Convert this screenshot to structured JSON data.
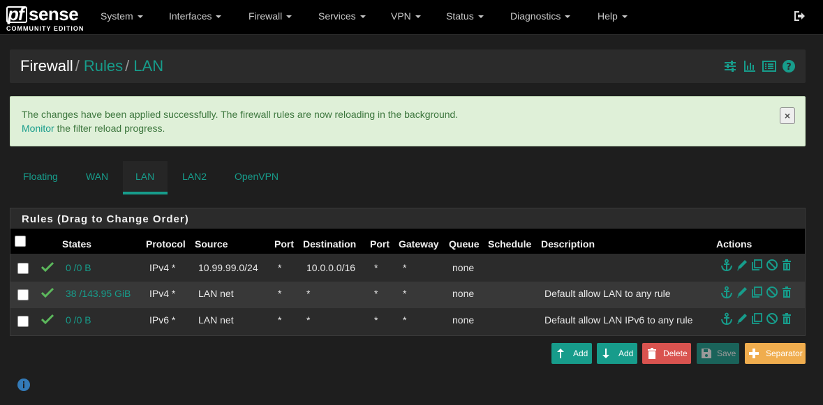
{
  "brand": {
    "logo_pf": "pf",
    "logo_sense": "sense",
    "edition": "COMMUNITY EDITION"
  },
  "nav": {
    "items": [
      "System",
      "Interfaces",
      "Firewall",
      "Services",
      "VPN",
      "Status",
      "Diagnostics",
      "Help"
    ]
  },
  "breadcrumb": {
    "root": "Firewall",
    "sep1": "/",
    "level1": "Rules",
    "sep2": "/",
    "level2": "LAN"
  },
  "alert": {
    "message": "The changes have been applied successfully. The firewall rules are now reloading in the background.",
    "link": "Monitor",
    "suffix": " the filter reload progress.",
    "close": "×"
  },
  "tabs": [
    "Floating",
    "WAN",
    "LAN",
    "LAN2",
    "OpenVPN"
  ],
  "active_tab": "LAN",
  "rules": {
    "title": "Rules (Drag to Change Order)",
    "columns": [
      "States",
      "Protocol",
      "Source",
      "Port",
      "Destination",
      "Port",
      "Gateway",
      "Queue",
      "Schedule",
      "Description",
      "Actions"
    ],
    "rows": [
      {
        "states": "0 /0 B",
        "protocol": "IPv4 *",
        "source": "10.99.99.0/24",
        "sport": "*",
        "destination": "10.0.0.0/16",
        "dport": "*",
        "gateway": "*",
        "queue": "none",
        "schedule": "",
        "description": ""
      },
      {
        "states": "38 /143.95 GiB",
        "protocol": "IPv4 *",
        "source": "LAN net",
        "sport": "*",
        "destination": "*",
        "dport": "*",
        "gateway": "*",
        "queue": "none",
        "schedule": "",
        "description": "Default allow LAN to any rule"
      },
      {
        "states": "0 /0 B",
        "protocol": "IPv6 *",
        "source": "LAN net",
        "sport": "*",
        "destination": "*",
        "dport": "*",
        "gateway": "*",
        "queue": "none",
        "schedule": "",
        "description": "Default allow LAN IPv6 to any rule"
      }
    ]
  },
  "buttons": {
    "add_top": "Add",
    "add_bottom": "Add",
    "delete": "Delete",
    "save": "Save",
    "separator": "Separator"
  },
  "colors": {
    "accent": "#179c8b",
    "success": "#5cb85c",
    "danger": "#d9534f",
    "warning": "#f0ad4e",
    "nav_bg": "#000000",
    "panel_bg": "#2b2b2b"
  },
  "icons": {
    "crumb": [
      "sliders-icon",
      "bar-chart-icon",
      "list-icon",
      "help-icon"
    ],
    "row_actions": [
      "anchor-icon",
      "pencil-icon",
      "copy-icon",
      "ban-icon",
      "trash-icon"
    ],
    "misc": [
      "logout-icon",
      "checkmark-icon",
      "info-icon"
    ]
  }
}
